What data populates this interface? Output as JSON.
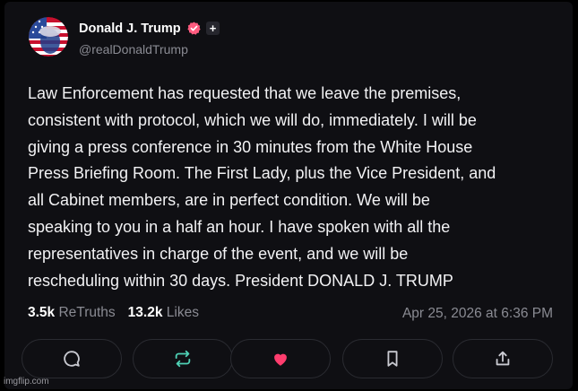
{
  "post": {
    "author_name": "Donald J. Trump",
    "handle": "@realDonaldTrump",
    "text": "Law Enforcement has requested that we leave the premises,\nconsistent with protocol, which we will do, immediately. I will be\ngiving a press conference in 30 minutes from the White House\nPress Briefing Room. The First Lady, plus the Vice President, and\nall Cabinet members, are in perfect condition. We will be\nspeaking to you in a half an hour. I have spoken with all the\nrepresentatives in charge of the event, and we will be\nrescheduling within 30 days. President DONALD J. TRUMP",
    "retruths_count": "3.5k",
    "retruths_label": "ReTruths",
    "likes_count": "13.2k",
    "likes_label": "Likes",
    "timestamp": "Apr 25, 2026 at 6:36 PM"
  },
  "actions": [
    {
      "icon": "comment-icon"
    },
    {
      "icon": "retruth-icon"
    },
    {
      "icon": "heart-icon"
    },
    {
      "icon": "bookmark-icon"
    },
    {
      "icon": "share-icon"
    }
  ],
  "colors": {
    "background": "#0f0f13",
    "accent_like": "#ff3d6e",
    "verified_badge": "#ff5b7f",
    "muted_text": "#8a8b93"
  },
  "watermark": "imgflip.com"
}
